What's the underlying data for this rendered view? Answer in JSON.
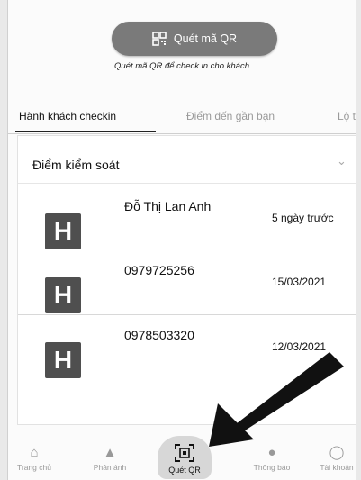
{
  "scan_button": {
    "label": "Quét mã QR"
  },
  "hint": "Quét mã QR để check in cho khách",
  "tabs": [
    {
      "label": "Hành khách checkin"
    },
    {
      "label": "Điểm đến gần bạn"
    },
    {
      "label": "Lộ tr"
    }
  ],
  "section": {
    "title": "Điểm kiểm soát"
  },
  "rows": [
    {
      "icon_letter": "H",
      "name": "Đỗ Thị Lan Anh",
      "time": "5 ngày trước"
    },
    {
      "icon_letter": "H",
      "name": "0979725256",
      "time": "15/03/2021"
    },
    {
      "icon_letter": "H",
      "name": "0978503320",
      "time": "12/03/2021"
    }
  ],
  "bottom_nav": [
    {
      "label": "Trang chủ",
      "icon": "home-icon"
    },
    {
      "label": "Phản ánh",
      "icon": "warning-icon"
    },
    {
      "label": "Quét QR",
      "icon": "qr-scan-icon"
    },
    {
      "label": "Thông báo",
      "icon": "bell-icon"
    },
    {
      "label": "Tài khoản",
      "icon": "account-icon"
    }
  ],
  "colors": {
    "button": "#7a7a7a",
    "icon_bg": "#4f4f4f"
  }
}
